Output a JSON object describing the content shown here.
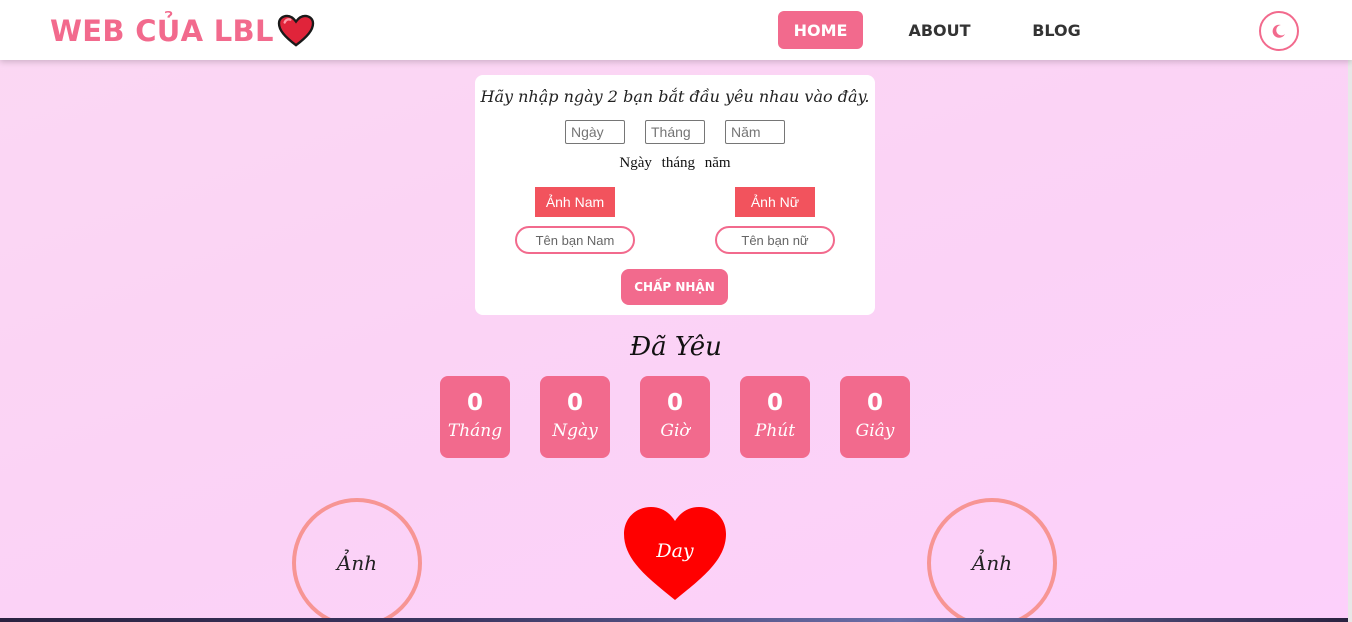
{
  "header": {
    "brand": "WEB CỦA LBL",
    "nav": [
      "HOME",
      "ABOUT",
      "BLOG"
    ],
    "active_nav": "HOME"
  },
  "form": {
    "title": "Hãy nhập ngày 2 bạn bắt đầu yêu nhau vào đây.",
    "day_placeholder": "Ngày",
    "month_placeholder": "Tháng",
    "year_placeholder": "Năm",
    "date_display": "Ngày tháng năm",
    "male_photo_button": "Ảnh Nam",
    "female_photo_button": "Ảnh Nữ",
    "male_name_placeholder": "Tên bạn Nam",
    "female_name_placeholder": "Tên bạn nữ",
    "accept_button": "CHẤP NHẬN"
  },
  "counter": {
    "title": "Đã Yêu",
    "units": [
      {
        "value": "0",
        "label": "Tháng"
      },
      {
        "value": "0",
        "label": "Ngày"
      },
      {
        "value": "0",
        "label": "Giờ"
      },
      {
        "value": "0",
        "label": "Phút"
      },
      {
        "value": "0",
        "label": "Giây"
      }
    ]
  },
  "couple": {
    "left_photo_label": "Ảnh",
    "right_photo_label": "Ảnh",
    "heart_label": "Day"
  },
  "colors": {
    "accent": "#f26a8d",
    "photo_button": "#f2535d",
    "heart": "#ff0000",
    "circle_border": "#f79594"
  },
  "icons": {
    "brand": "heart-icon",
    "theme_toggle": "moon-icon",
    "center": "heart-icon"
  }
}
